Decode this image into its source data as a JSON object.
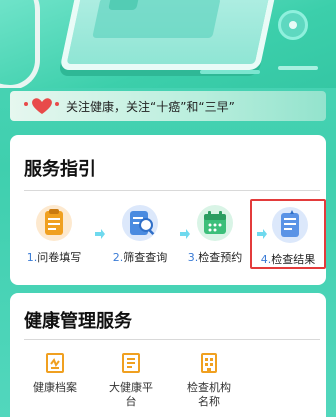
{
  "notice": {
    "text": "关注健康，关注“十癌”和“三早”"
  },
  "guide": {
    "title": "服务指引",
    "steps": [
      {
        "num": "1.",
        "label": "问卷填写",
        "icon": "clipboard-icon",
        "active": false
      },
      {
        "num": "2.",
        "label": "筛查查询",
        "icon": "search-doc-icon",
        "active": false
      },
      {
        "num": "3.",
        "label": "检查预约",
        "icon": "calendar-icon",
        "active": false
      },
      {
        "num": "4.",
        "label": "检查结果",
        "icon": "report-icon",
        "active": true
      }
    ]
  },
  "health": {
    "title": "健康管理服务",
    "items": [
      {
        "label": "健康档案",
        "icon": "health-record-icon"
      },
      {
        "label": "大健康平\n台",
        "icon": "platform-icon"
      },
      {
        "label": "检查机构\n名称",
        "icon": "institution-icon"
      }
    ]
  },
  "colors": {
    "accent": "#3fcfae",
    "highlight": "#e33b3b",
    "icon_orange": "#f0a020",
    "step_num": "#3a7bd5"
  }
}
